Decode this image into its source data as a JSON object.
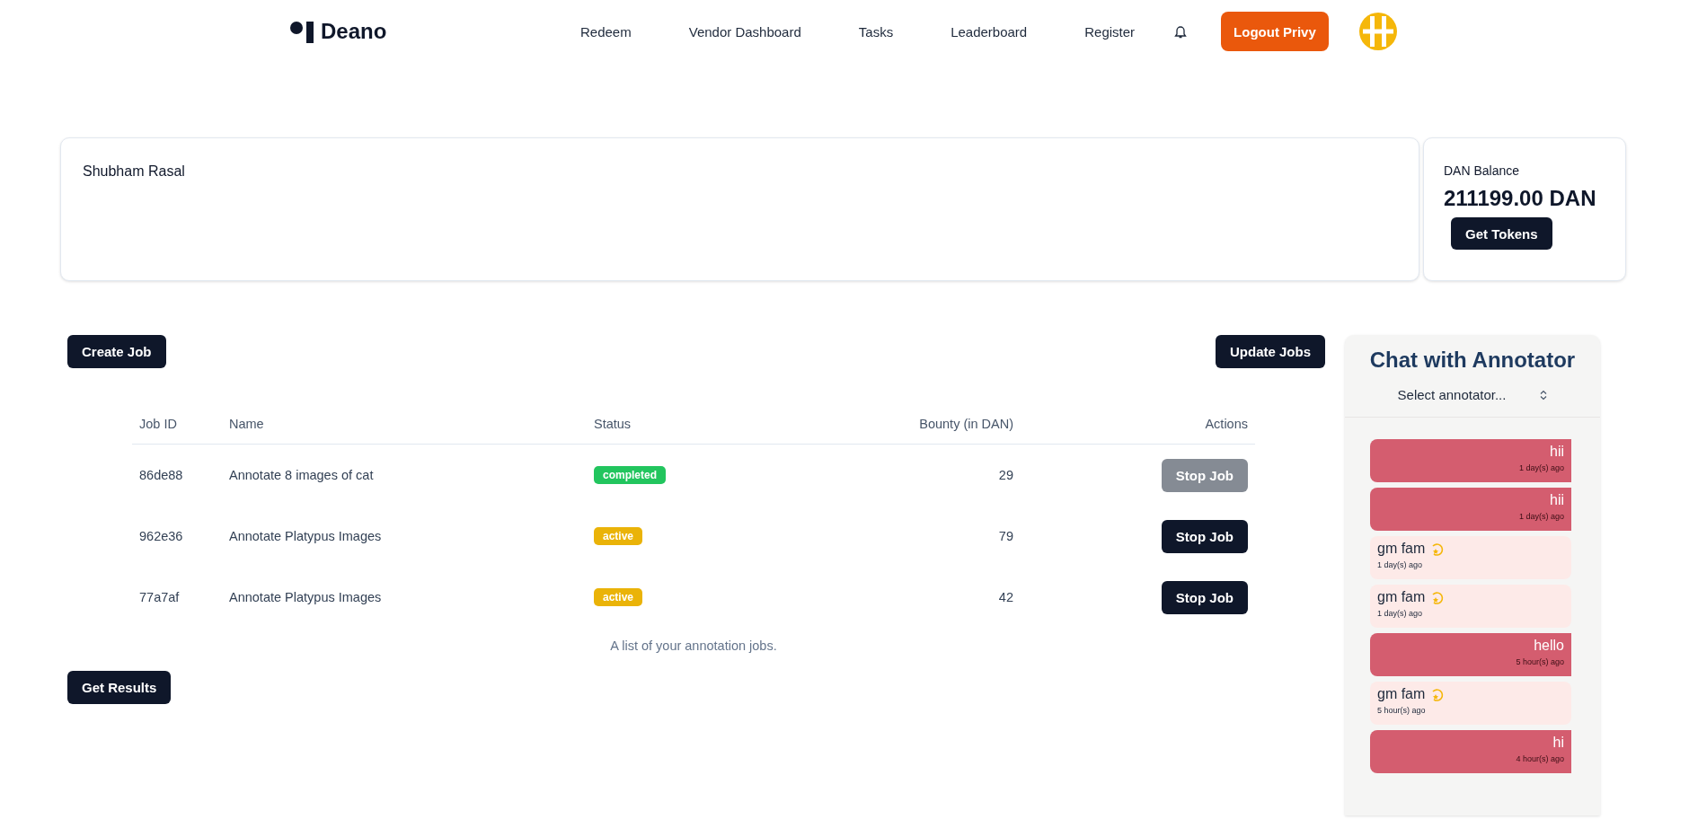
{
  "header": {
    "brand": "Deano",
    "nav": [
      "Redeem",
      "Vendor Dashboard",
      "Tasks",
      "Leaderboard",
      "Register"
    ],
    "logout_button": "Logout Privy"
  },
  "profile": {
    "name": "Shubham Rasal"
  },
  "balance": {
    "label": "DAN Balance",
    "amount": "211199.00 DAN",
    "button": "Get Tokens"
  },
  "jobs": {
    "create_button": "Create Job",
    "update_button": "Update Jobs",
    "columns": [
      "Job ID",
      "Name",
      "Status",
      "Bounty (in DAN)",
      "Actions"
    ],
    "rows": [
      {
        "id": "86de88",
        "name": "Annotate 8 images of cat",
        "status": "completed",
        "bounty": "29",
        "action": "Stop Job",
        "disabled": true
      },
      {
        "id": "962e36",
        "name": "Annotate Platypus Images",
        "status": "active",
        "bounty": "79",
        "action": "Stop Job",
        "disabled": false
      },
      {
        "id": "77a7af",
        "name": "Annotate Platypus Images",
        "status": "active",
        "bounty": "42",
        "action": "Stop Job",
        "disabled": false
      }
    ],
    "caption": "A list of your annotation jobs.",
    "results_button": "Get Results"
  },
  "chat": {
    "title": "Chat with Annotator",
    "select": {
      "placeholder": "Select annotator..."
    },
    "messages": [
      {
        "kind": "sent",
        "text": "hii",
        "time": "1 day(s) ago",
        "emoji": false
      },
      {
        "kind": "sent",
        "text": "hii",
        "time": "1 day(s) ago",
        "emoji": false
      },
      {
        "kind": "received",
        "text": "gm fam",
        "time": "1 day(s) ago",
        "emoji": true
      },
      {
        "kind": "received",
        "text": "gm fam",
        "time": "1 day(s) ago",
        "emoji": true
      },
      {
        "kind": "sent",
        "text": "hello",
        "time": "5 hour(s) ago",
        "emoji": false
      },
      {
        "kind": "received",
        "text": "gm fam",
        "time": "5 hour(s) ago",
        "emoji": true
      },
      {
        "kind": "sent",
        "text": "hi",
        "time": "4 hour(s) ago",
        "emoji": false
      }
    ]
  }
}
